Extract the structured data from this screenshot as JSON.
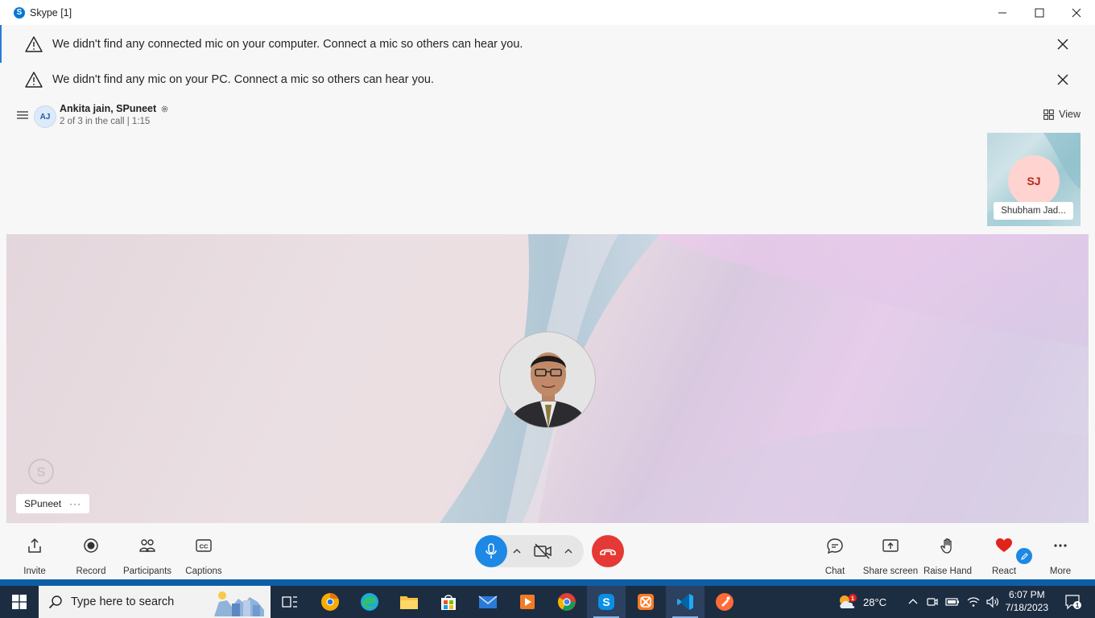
{
  "window": {
    "title": "Skype [1]"
  },
  "notifications": [
    {
      "message": "We didn't find any connected mic on your computer. Connect a mic so others can hear you."
    },
    {
      "message": "We didn't find any mic on your PC. Connect a mic so others can hear you."
    }
  ],
  "call": {
    "avatar_initials": "AJ",
    "title": "Ankita jain, SPuneet",
    "subtitle": "2 of 3 in the call | 1:15",
    "view_label": "View"
  },
  "participant_tile": {
    "initials": "SJ",
    "name": "Shubham Jad..."
  },
  "stage": {
    "speaker_name": "SPuneet",
    "more_label": "···"
  },
  "controls": {
    "left": [
      {
        "label": "Invite",
        "icon": "share-icon"
      },
      {
        "label": "Record",
        "icon": "record-icon"
      },
      {
        "label": "Participants",
        "icon": "participants-icon"
      },
      {
        "label": "Captions",
        "icon": "captions-icon"
      }
    ],
    "right": [
      {
        "label": "Chat",
        "icon": "chat-icon"
      },
      {
        "label": "Share screen",
        "icon": "share-screen-icon"
      },
      {
        "label": "Raise Hand",
        "icon": "hand-icon"
      },
      {
        "label": "React",
        "icon": "heart-icon"
      },
      {
        "label": "More",
        "icon": "more-icon"
      }
    ]
  },
  "taskbar": {
    "search_placeholder": "Type here to search",
    "weather": "28°C",
    "time": "6:07 PM",
    "date": "7/18/2023",
    "notification_count": "1",
    "weather_badge": "1"
  },
  "colors": {
    "accent_blue": "#1e88e5",
    "hangup_red": "#e53935",
    "taskbar_bg": "#1c2d42"
  }
}
